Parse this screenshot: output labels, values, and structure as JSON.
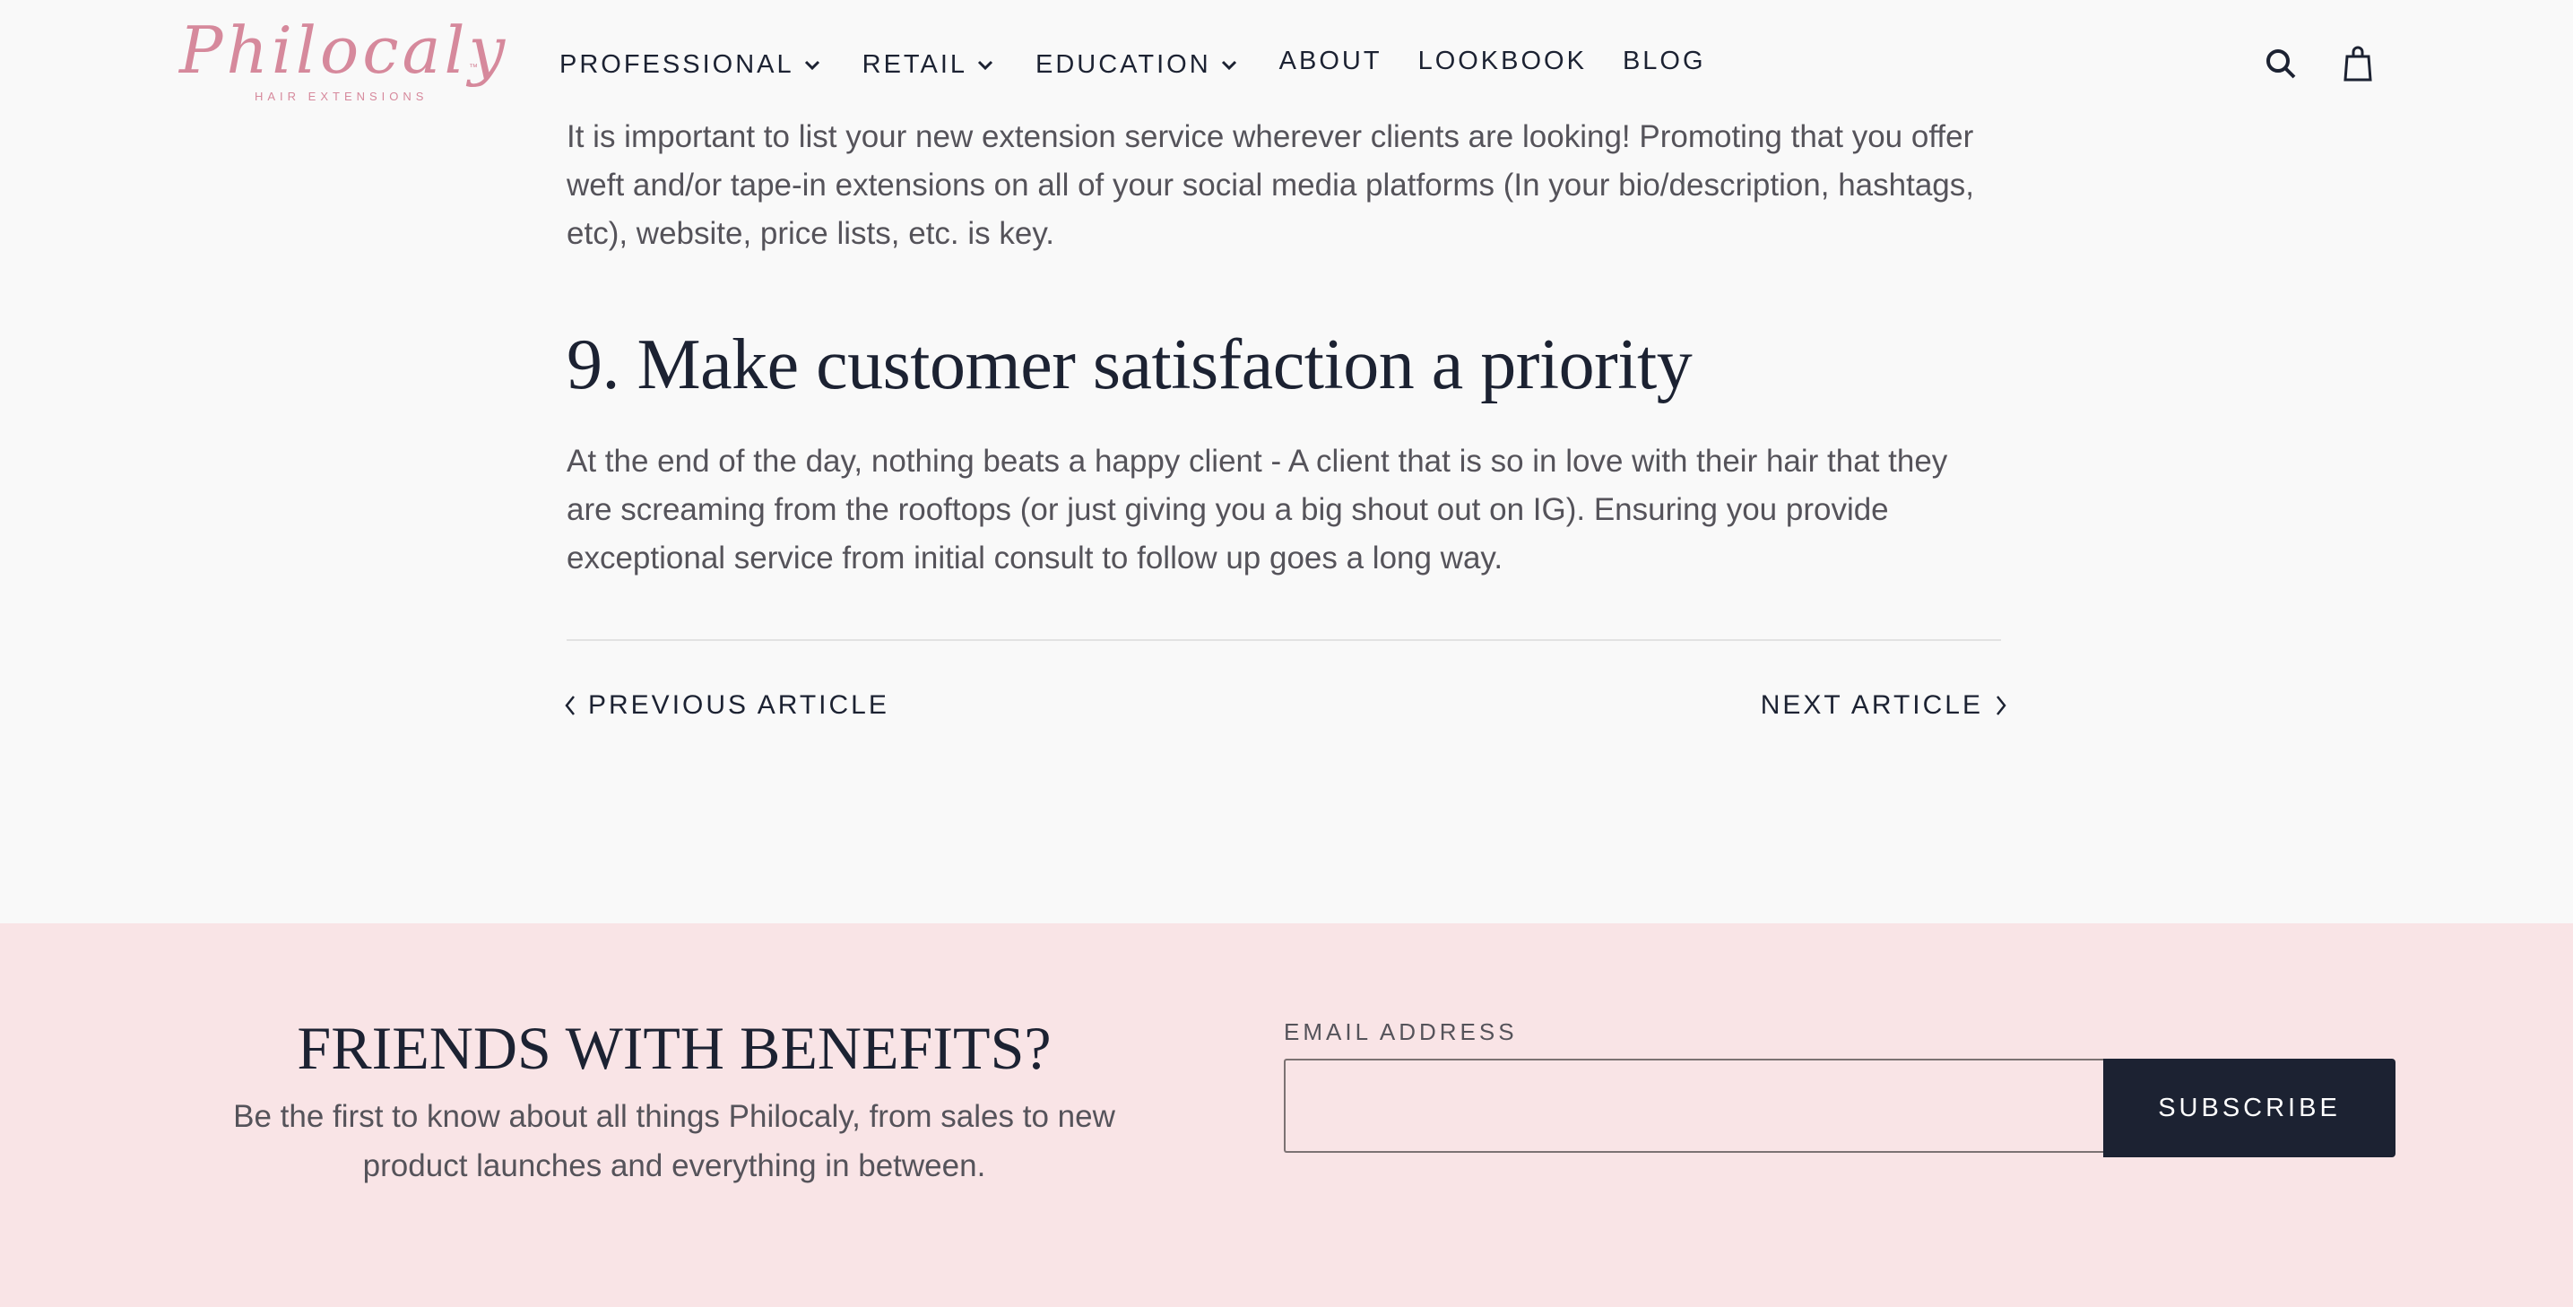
{
  "brand": {
    "name": "Philocaly",
    "tm": "™",
    "tagline": "HAIR EXTENSIONS",
    "color": "#d6899c"
  },
  "nav": {
    "items": [
      {
        "label": "PROFESSIONAL",
        "has_dropdown": true
      },
      {
        "label": "RETAIL",
        "has_dropdown": true
      },
      {
        "label": "EDUCATION",
        "has_dropdown": true
      },
      {
        "label": "ABOUT",
        "has_dropdown": false
      },
      {
        "label": "LOOKBOOK",
        "has_dropdown": false
      },
      {
        "label": "BLOG",
        "has_dropdown": false
      }
    ],
    "icons": [
      "search-icon",
      "shopping-bag-icon"
    ]
  },
  "article": {
    "paragraph_top": "It is important to list your new extension service wherever clients are looking! Promoting that you offer weft and/or tape-in extensions on all of your social media platforms (In your bio/description, hashtags, etc), website, price lists, etc. is key.",
    "heading": "9. Make customer satisfaction a priority",
    "paragraph_second": "At the end of the day, nothing beats a happy client - A client that is so in love with their hair that they are screaming from the rooftops (or just giving you a big shout out on IG). Ensuring you provide exceptional service from initial consult to follow up goes a long way.",
    "prev_label": "PREVIOUS ARTICLE",
    "next_label": "NEXT ARTICLE"
  },
  "newsletter": {
    "title": "FRIENDS WITH BENEFITS?",
    "description": "Be the first to know about all things Philocaly, from sales to new product launches and everything in between.",
    "email_label": "EMAIL ADDRESS",
    "email_value": "",
    "email_placeholder": "",
    "button_label": "SUBSCRIBE",
    "background_color": "#f9e4e6",
    "button_color": "#1c2232"
  }
}
